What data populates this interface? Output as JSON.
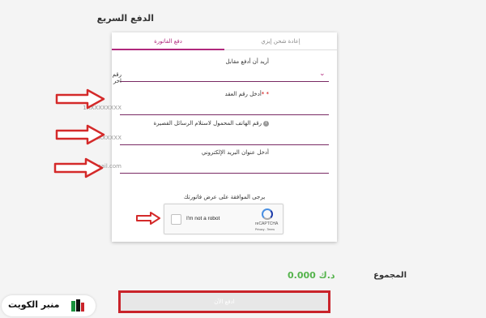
{
  "page": {
    "title": "الدفع السريع"
  },
  "tabs": [
    {
      "label": "دفع الفاتورة",
      "active": true
    },
    {
      "label": "إعادة شحن إيزي",
      "active": false
    }
  ],
  "form": {
    "pay_for_label": "أريد أن أدفع مقابل",
    "pay_for_value": "رقم اخر",
    "contract_label": "أدخل رقم العقد",
    "contract_required_mark": "* *",
    "contract_placeholder": "1XXXXXXXXX",
    "phone_label": "رقم الهاتف المحمول لاستلام الرسائل القصيرة",
    "phone_placeholder": "9XXXXXXXXX",
    "email_label": "أدخل عنوان البريد الإلكتروني",
    "email_placeholder": "xxx@gmail.com"
  },
  "consent": {
    "text": "يرجى الموافقة على عرض فاتورتك"
  },
  "captcha": {
    "text": "I'm not a robot",
    "brand": "reCAPTCHA",
    "links": "Privacy - Terms"
  },
  "summary": {
    "total_label": "المجموع",
    "total_value": "0.000 د.ك"
  },
  "pay_button": {
    "label": "ادفع الآن"
  },
  "watermark": {
    "text": "منبر الكويت"
  },
  "colors": {
    "accent": "#b0287d",
    "field_underline": "#7a2a64",
    "total": "#55b34c",
    "highlight": "#c9232a"
  },
  "icons": {
    "dropdown": "chevron-down-icon",
    "info": "info-icon",
    "annotation": "arrow-right-icon"
  }
}
